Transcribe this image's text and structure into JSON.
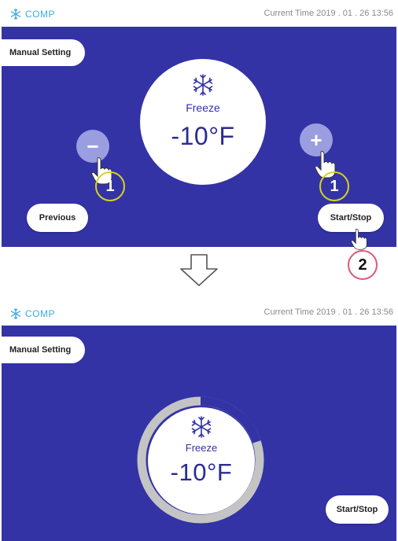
{
  "status_bar": {
    "app_label": "COMP",
    "time_text": "Current Time  2019 . 01 . 26  13:56"
  },
  "screen": {
    "mode_tab": "Manual Setting",
    "mode_label": "Freeze",
    "temperature": "-10°F",
    "minus_symbol": "−",
    "plus_symbol": "+",
    "previous_button": "Previous",
    "start_stop_button": "Start/Stop"
  },
  "steps": {
    "step_1_minus": "1",
    "step_1_plus": "1",
    "step_2": "2"
  },
  "progress": {
    "ring_fraction": 0.2
  },
  "colors": {
    "screen_background": "#3333a6",
    "accent": "#3fa9e0",
    "button_soft": "#9a9ee0",
    "step_1_ring": "#d7d21e",
    "step_2_ring": "#e0567a"
  },
  "icons": [
    "snowflake-icon",
    "hand-pointer-icon",
    "down-arrow-icon"
  ]
}
